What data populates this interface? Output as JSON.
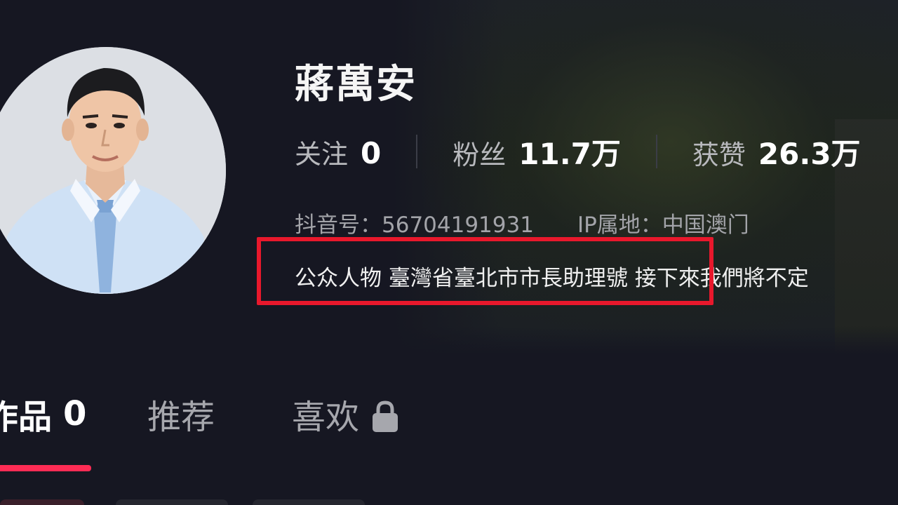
{
  "profile": {
    "name": "蔣萬安",
    "stats": [
      {
        "label": "关注",
        "value": "0"
      },
      {
        "label": "粉丝",
        "value": "11.7万"
      },
      {
        "label": "获赞",
        "value": "26.3万"
      }
    ],
    "douyin_id": "抖音号：56704191931",
    "ip_location": "IP属地：中国澳门",
    "bio": "公众人物 臺灣省臺北市市長助理號 接下來我們將不定"
  },
  "tabs": [
    {
      "label": "作品",
      "count": "0"
    },
    {
      "label": "推荐"
    },
    {
      "label": "喜欢",
      "icon": "lock-icon"
    }
  ],
  "colors": {
    "background": "#161722",
    "accent": "#fe2c55",
    "highlight_box": "#e8182c",
    "muted_text": "#a3a4a9"
  }
}
